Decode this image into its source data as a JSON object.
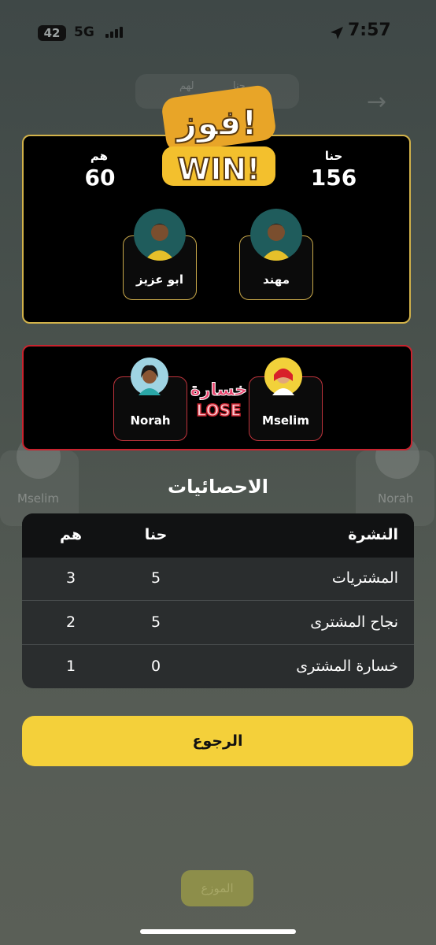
{
  "status_bar": {
    "battery": "42",
    "network": "5G",
    "time": "7:57"
  },
  "background": {
    "tab_right": "حنا",
    "tab_left": "لهم",
    "left_player": "Mselim",
    "right_player": "Norah",
    "logo": "barq",
    "distributor_button": "الموزع"
  },
  "win_panel": {
    "badge_ar": "فوز!",
    "badge_en": "WIN!",
    "us_label": "حنا",
    "us_score": "156",
    "them_label": "هم",
    "them_score": "60",
    "players": [
      {
        "name": "مهند"
      },
      {
        "name": "ابو عزيز"
      }
    ]
  },
  "lose_panel": {
    "badge_ar": "خسارة",
    "badge_en": "LOSE",
    "players": [
      {
        "name": "Mselim"
      },
      {
        "name": "Norah"
      }
    ]
  },
  "stats": {
    "title": "الاحصائيات",
    "headers": {
      "label": "النشرة",
      "us": "حنا",
      "them": "هم"
    },
    "rows": [
      {
        "label": "المشتريات",
        "us": "5",
        "them": "3"
      },
      {
        "label": "نجاح المشترى",
        "us": "5",
        "them": "2"
      },
      {
        "label": "خسارة المشترى",
        "us": "0",
        "them": "1"
      }
    ]
  },
  "back_button": "الرجوع",
  "colors": {
    "accent_yellow": "#f4d03a",
    "win_border": "#d2b24a",
    "lose_border": "#c9232e"
  }
}
